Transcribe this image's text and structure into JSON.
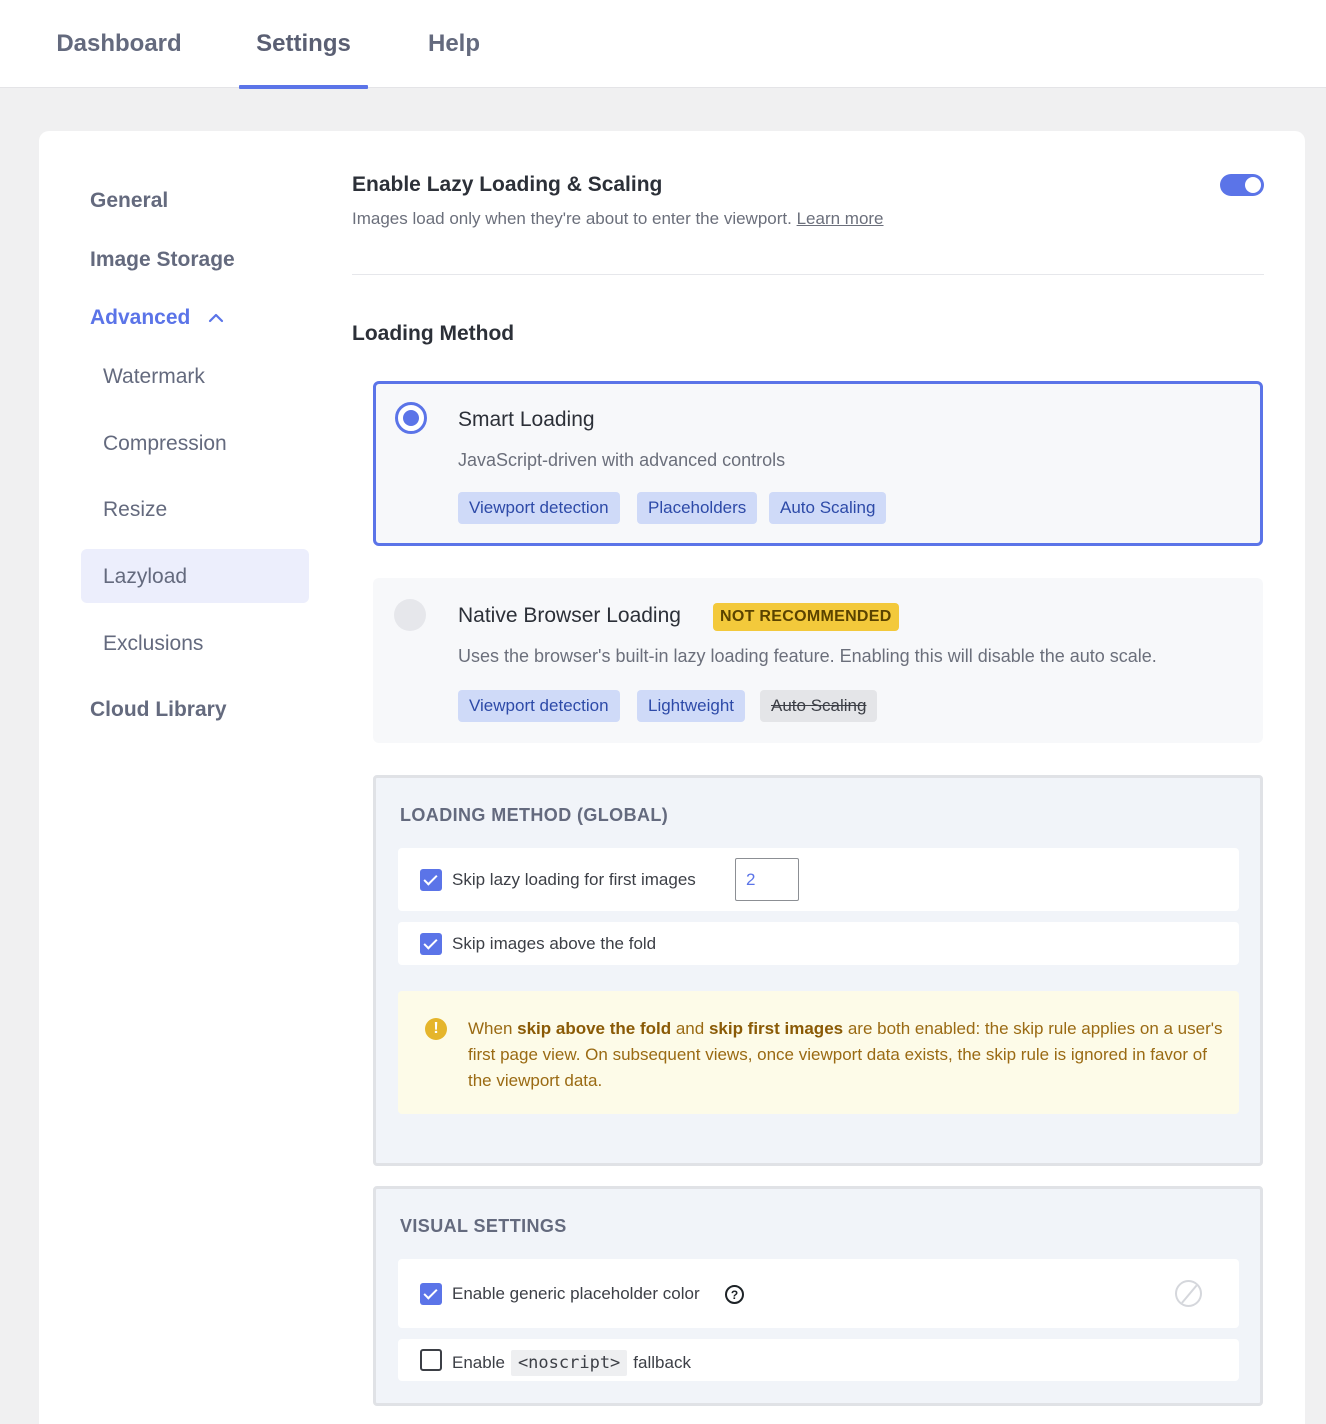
{
  "tabs": {
    "dashboard": "Dashboard",
    "settings": "Settings",
    "help": "Help"
  },
  "sidebar": {
    "general": "General",
    "image_storage": "Image Storage",
    "advanced": "Advanced",
    "watermark": "Watermark",
    "compression": "Compression",
    "resize": "Resize",
    "lazyload": "Lazyload",
    "exclusions": "Exclusions",
    "cloud_library": "Cloud Library"
  },
  "main": {
    "enable_title": "Enable Lazy Loading & Scaling",
    "enable_desc": "Images load only when they're about to enter the viewport.",
    "learn_more": "Learn more",
    "toggle_on": true,
    "loading_method_title": "Loading Method",
    "smart": {
      "title": "Smart Loading",
      "desc": "JavaScript-driven with advanced controls",
      "chips": [
        "Viewport detection",
        "Placeholders",
        "Auto Scaling"
      ],
      "selected": true
    },
    "native": {
      "title": "Native Browser Loading",
      "badge": "NOT RECOMMENDED",
      "desc": "Uses the browser's built-in lazy loading feature. Enabling this will disable the auto scale.",
      "chips": [
        "Viewport detection",
        "Lightweight",
        "Auto Scaling"
      ],
      "selected": false
    },
    "global": {
      "title": "LOADING METHOD (GLOBAL)",
      "skip_first_label": "Skip lazy loading for first images",
      "skip_first_value": "2",
      "skip_fold_label": "Skip images above the fold",
      "notice_prefix": "When ",
      "notice_bold1": "skip above the fold",
      "notice_mid": " and ",
      "notice_bold2": "skip first images",
      "notice_rest": " are both enabled: the skip rule applies on a user's first page view. On subsequent views, once viewport data exists, the skip rule is ignored in favor of the viewport data."
    },
    "visual": {
      "title": "VISUAL SETTINGS",
      "placeholder_label": "Enable generic placeholder color",
      "noscript_prefix": "Enable",
      "noscript_code": "<noscript>",
      "noscript_suffix": "fallback"
    }
  },
  "colors": {
    "accent": "#5b74e8",
    "badge_yellow": "#f3c93b",
    "notice_bg": "#fdfbe8"
  }
}
